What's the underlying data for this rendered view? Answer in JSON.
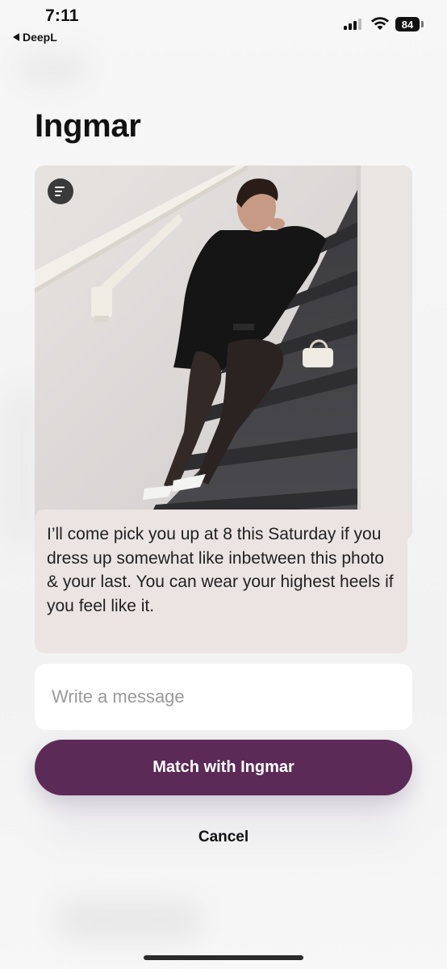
{
  "status_bar": {
    "time": "7:11",
    "back_app": "DeepL",
    "battery_level": "84"
  },
  "profile": {
    "name": "Ingmar"
  },
  "photo": {
    "description_icon": "prompt-lines-icon"
  },
  "comment": {
    "text": "I’ll come pick you up at 8 this Saturday if you dress up somewhat like inbetween this photo & your last. You can wear your highest heels if you feel like it."
  },
  "message_input": {
    "placeholder": "Write a message",
    "value": ""
  },
  "actions": {
    "match_label": "Match with Ingmar",
    "cancel_label": "Cancel"
  },
  "colors": {
    "match_button": "#5c2a56",
    "comment_bubble": "#ebe4e2",
    "background": "#f6f6f6"
  }
}
